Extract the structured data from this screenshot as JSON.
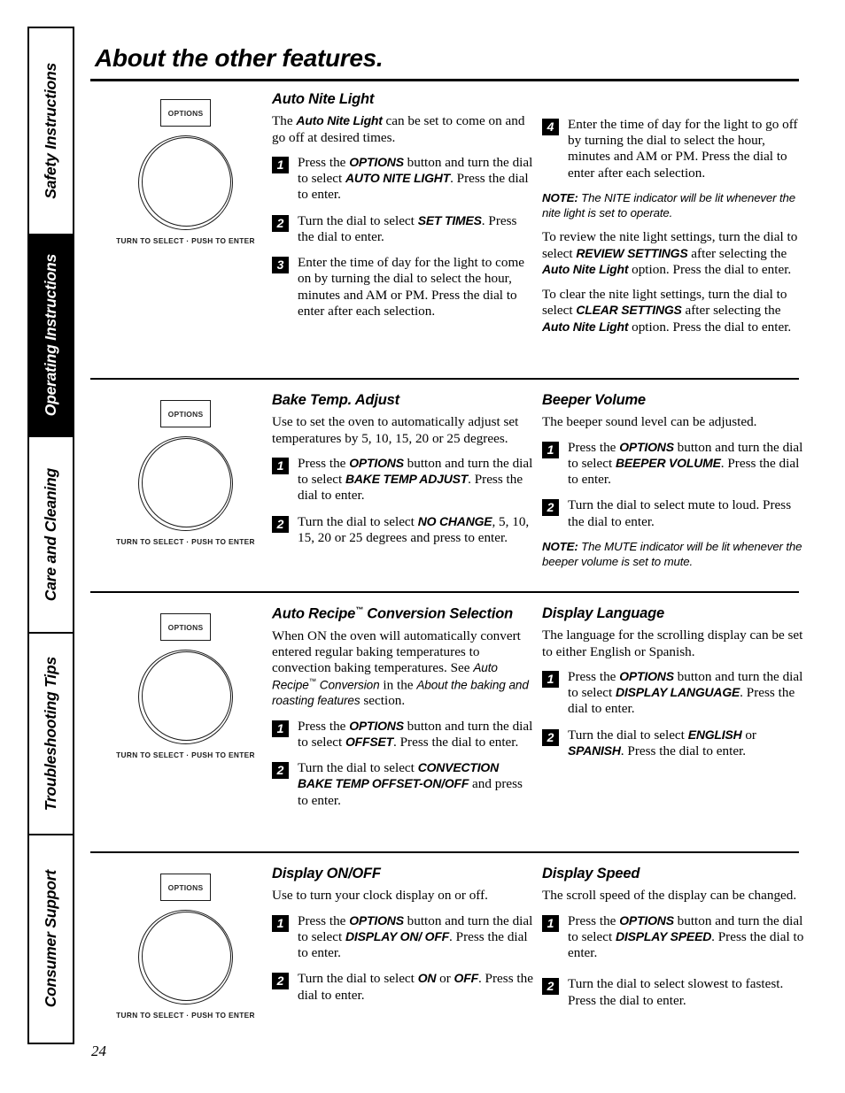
{
  "sidebar": {
    "tabs": [
      {
        "label": "Safety Instructions",
        "active": false
      },
      {
        "label": "Operating Instructions",
        "active": true
      },
      {
        "label": "Care and Cleaning",
        "active": false
      },
      {
        "label": "Troubleshooting Tips",
        "active": false
      },
      {
        "label": "Consumer Support",
        "active": false
      }
    ]
  },
  "page": {
    "title": "About the other features.",
    "number": "24"
  },
  "dial": {
    "button_label": "OPTIONS",
    "caption": "TURN TO SELECT  ·  PUSH TO ENTER"
  },
  "sections": {
    "auto_nite_light": {
      "heading": "Auto Nite Light",
      "intro_a": "The ",
      "intro_b": "Auto Nite Light",
      "intro_c": " can be set to come on and go off at desired times.",
      "step1": {
        "num": "1",
        "a": "Press the ",
        "b": "OPTIONS",
        "c": " button and turn the dial to select ",
        "d": "AUTO NITE LIGHT",
        "e": ". Press the dial to enter."
      },
      "step2": {
        "num": "2",
        "a": "Turn the dial to select ",
        "b": "SET TIMES",
        "c": ". Press the dial to enter."
      },
      "step3": {
        "num": "3",
        "a": "Enter the time of day for the light to come on by turning the dial to select the hour, minutes and AM or PM. Press the dial to enter after each selection."
      },
      "step4": {
        "num": "4",
        "a": "Enter the time of day for the light to go off by turning the dial to select the hour, minutes and AM or PM. Press the dial to enter after each selection."
      },
      "note_label": "NOTE:",
      "note_text": " The NITE indicator will be lit whenever the nite light is set to operate.",
      "review_a": "To review the nite light settings, turn the dial to select ",
      "review_b": "REVIEW SETTINGS",
      "review_c": " after selecting the ",
      "review_d": "Auto Nite Light",
      "review_e": " option. Press the dial to enter.",
      "clear_a": "To clear the nite light settings, turn the dial to select ",
      "clear_b": "CLEAR SETTINGS",
      "clear_c": " after selecting the ",
      "clear_d": "Auto Nite Light",
      "clear_e": " option. Press the dial to enter."
    },
    "bake_temp_adjust": {
      "heading": "Bake Temp. Adjust",
      "intro": "Use to set the oven to automatically adjust set temperatures by 5, 10, 15, 20 or 25 degrees.",
      "step1": {
        "num": "1",
        "a": "Press the ",
        "b": "OPTIONS",
        "c": " button and turn the dial to select ",
        "d": "BAKE TEMP ADJUST",
        "e": ". Press the dial to enter."
      },
      "step2": {
        "num": "2",
        "a": "Turn the dial to select ",
        "b": "NO CHANGE",
        "c": ", 5, 10, 15, 20 or 25 degrees and press to enter."
      }
    },
    "beeper_volume": {
      "heading": "Beeper Volume",
      "intro": "The beeper sound level can be adjusted.",
      "step1": {
        "num": "1",
        "a": "Press the ",
        "b": "OPTIONS",
        "c": " button and turn the dial to select ",
        "d": "BEEPER VOLUME",
        "e": ". Press the dial to enter."
      },
      "step2": {
        "num": "2",
        "a": "Turn the dial to select mute to loud. Press the dial to enter."
      },
      "note_label": "NOTE:",
      "note_text": " The MUTE indicator will be lit whenever the beeper volume is set to mute."
    },
    "auto_recipe": {
      "heading_a": "Auto Recipe",
      "heading_tm": "™",
      "heading_b": " Conversion Selection",
      "intro_a": "When ON the oven will automatically convert entered regular baking temperatures to convection baking temperatures. See ",
      "intro_b": "Auto Recipe",
      "intro_tm": "™",
      "intro_c": " Conversion",
      "intro_d": " in the ",
      "intro_e": "About the baking and roasting features",
      "intro_f": " section.",
      "step1": {
        "num": "1",
        "a": "Press the ",
        "b": "OPTIONS",
        "c": " button and turn the dial to select ",
        "d": "OFFSET",
        "e": ". Press the dial to enter."
      },
      "step2": {
        "num": "2",
        "a": "Turn the dial to select ",
        "b": "CONVECTION BAKE TEMP OFFSET-ON/OFF",
        "c": " and press to enter."
      }
    },
    "display_language": {
      "heading": "Display Language",
      "intro": "The language for the scrolling display can be set to either English or Spanish.",
      "step1": {
        "num": "1",
        "a": "Press the ",
        "b": "OPTIONS",
        "c": " button and turn the dial to select ",
        "d": "DISPLAY LANGUAGE",
        "e": ". Press the dial to enter."
      },
      "step2": {
        "num": "2",
        "a": "Turn the dial to select ",
        "b": "ENGLISH",
        "c": " or ",
        "d": "SPANISH",
        "e": ". Press the dial to enter."
      }
    },
    "display_onoff": {
      "heading": "Display ON/OFF",
      "intro": "Use to turn your clock display on or off.",
      "step1": {
        "num": "1",
        "a": "Press the ",
        "b": "OPTIONS",
        "c": " button and turn the dial to select ",
        "d": "DISPLAY ON/ OFF",
        "e": ". Press the dial to enter."
      },
      "step2": {
        "num": "2",
        "a": "Turn the dial to select ",
        "b": "ON",
        "c": " or ",
        "d": "OFF",
        "e": ". Press the dial to enter."
      }
    },
    "display_speed": {
      "heading": "Display Speed",
      "intro": "The scroll speed of the display can be changed.",
      "step1": {
        "num": "1",
        "a": "Press the ",
        "b": "OPTIONS",
        "c": " button and turn the dial to select ",
        "d": "DISPLAY SPEED",
        "e": ". Press the dial to enter."
      },
      "step2": {
        "num": "2",
        "a": "Turn the dial to select slowest to fastest. Press the dial to enter."
      }
    }
  }
}
